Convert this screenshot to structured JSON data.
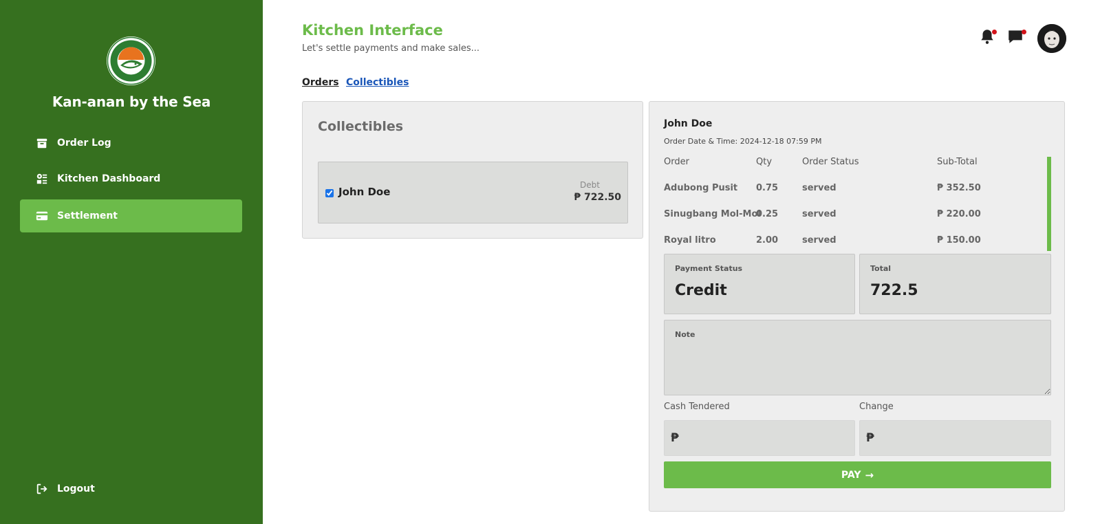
{
  "brand": {
    "name": "Kan-anan by the Sea",
    "logo_text": "KAN-ANAN BY THE SEA",
    "logo_subtext": "TALISAYAN, M.O."
  },
  "sidebar": {
    "items": [
      {
        "label": "Order Log",
        "icon": "archive-icon"
      },
      {
        "label": "Kitchen Dashboard",
        "icon": "dashboard-icon"
      },
      {
        "label": "Settlement",
        "icon": "card-icon",
        "active": true
      }
    ],
    "logout_label": "Logout"
  },
  "header": {
    "title": "Kitchen Interface",
    "subtitle": "Let's settle payments and make sales..."
  },
  "tabs": {
    "orders_label": "Orders",
    "collectibles_label": "Collectibles"
  },
  "collectibles": {
    "heading": "Collectibles",
    "items": [
      {
        "name": "John Doe",
        "debt_label": "Debt",
        "debt_value": "₱ 722.50",
        "checked": true
      }
    ]
  },
  "detail": {
    "customer_name": "John Doe",
    "order_datetime_label": "Order Date & Time:",
    "order_datetime_value": "2024-12-18 07:59 PM",
    "table": {
      "headers": [
        "Order",
        "Qty",
        "Order Status",
        "Sub-Total"
      ],
      "rows": [
        [
          "Adubong Pusit",
          "0.75",
          "served",
          "₱ 352.50"
        ],
        [
          "Sinugbang Mol-Mol",
          "0.25",
          "served",
          "₱ 220.00"
        ],
        [
          "Royal litro",
          "2.00",
          "served",
          "₱ 150.00"
        ]
      ]
    },
    "payment_status_label": "Payment Status",
    "payment_status_value": "Credit",
    "total_label": "Total",
    "total_value": "722.5",
    "note_label": "Note",
    "note_value": "",
    "cash_tendered_label": "Cash Tendered",
    "change_label": "Change",
    "currency_symbol": "₱",
    "cash_tendered_value": "",
    "change_value": "",
    "pay_label": "PAY",
    "pay_arrow": "→"
  },
  "colors": {
    "sidebar_bg": "#36701f",
    "accent_green": "#6cbb4a",
    "link_blue": "#1a56b8",
    "notification_dot": "#d3141b"
  }
}
